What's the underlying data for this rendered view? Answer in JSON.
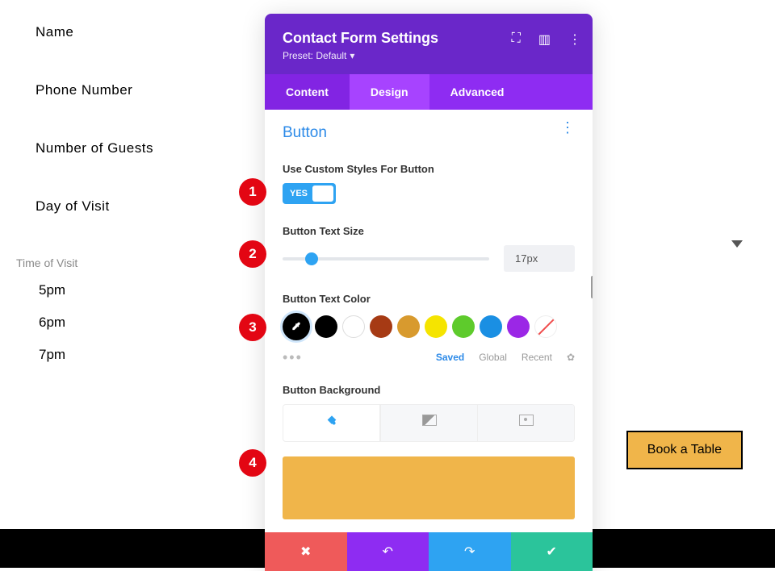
{
  "form": {
    "fields": [
      "Name",
      "Phone Number",
      "Number of Guests",
      "Day of Visit"
    ],
    "time_label": "Time of Visit",
    "times": [
      "5pm",
      "6pm",
      "7pm"
    ],
    "submit": "Book a Table"
  },
  "modal": {
    "title": "Contact Form Settings",
    "preset": "Preset: Default",
    "tabs": {
      "content": "Content",
      "design": "Design",
      "advanced": "Advanced"
    },
    "section": "Button",
    "custom_styles_label": "Use Custom Styles For Button",
    "toggle_value": "YES",
    "text_size_label": "Button Text Size",
    "text_size_value": "17px",
    "text_color_label": "Button Text Color",
    "swatches": [
      "#000000",
      "#000000",
      "#ffffff",
      "#a63a14",
      "#d89a2e",
      "#f5e400",
      "#5ecb2c",
      "#1a8fe3",
      "#9b27e6"
    ],
    "color_tabs": {
      "saved": "Saved",
      "global": "Global",
      "recent": "Recent"
    },
    "bg_label": "Button Background",
    "bg_color": "#f0b54a"
  },
  "callouts": [
    "1",
    "2",
    "3",
    "4"
  ]
}
